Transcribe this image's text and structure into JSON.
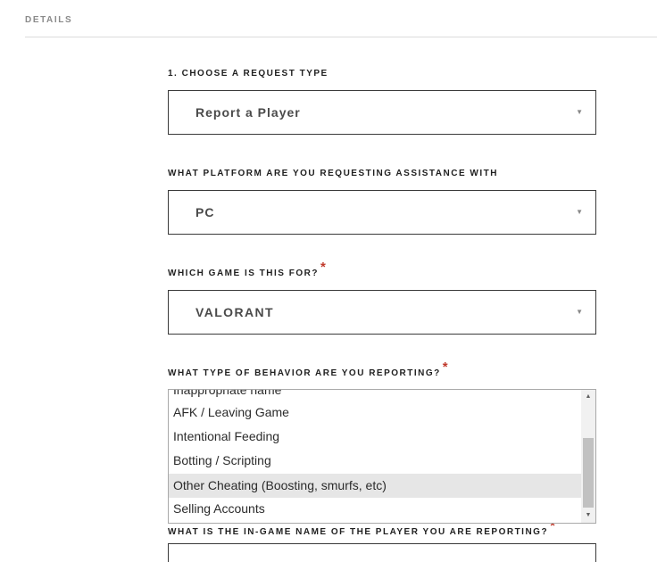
{
  "section": {
    "title": "DETAILS"
  },
  "request_type": {
    "label": "1. CHOOSE A REQUEST TYPE",
    "value": "Report a Player"
  },
  "platform": {
    "label": "WHAT PLATFORM ARE YOU REQUESTING ASSISTANCE WITH",
    "value": "PC"
  },
  "game": {
    "label": "WHICH GAME IS THIS FOR?",
    "required_mark": "*",
    "value": "VALORANT"
  },
  "behavior": {
    "label": "WHAT TYPE OF BEHAVIOR ARE YOU REPORTING?",
    "required_mark": "*",
    "options": [
      "Inappropriate name",
      "AFK / Leaving Game",
      "Intentional Feeding",
      "Botting / Scripting",
      "Other Cheating (Boosting, smurfs, etc)",
      "Selling Accounts"
    ],
    "highlighted": "Other Cheating (Boosting, smurfs, etc)"
  },
  "player_name": {
    "label": "WHAT IS THE IN-GAME NAME OF THE PLAYER YOU ARE REPORTING?",
    "required_mark": "*"
  },
  "icons": {
    "caret": "caret-down-icon",
    "scroll_up": "scroll-up-arrow-icon",
    "scroll_down": "scroll-down-arrow-icon"
  },
  "colors": {
    "required": "#c0392b",
    "border": "#3a3a3a",
    "highlight": "#e6e6e6"
  }
}
